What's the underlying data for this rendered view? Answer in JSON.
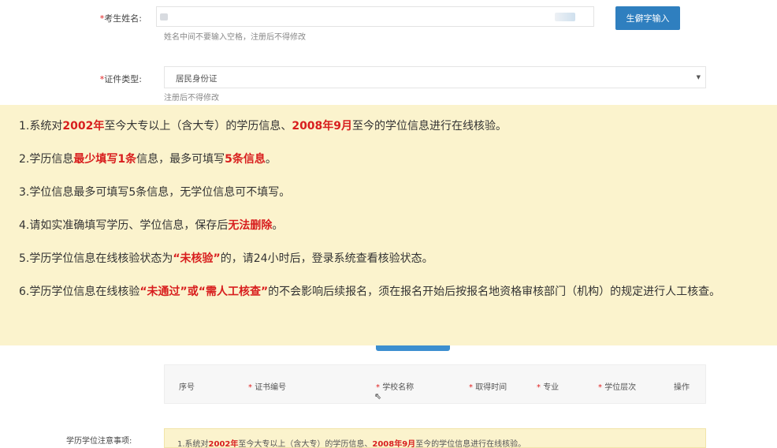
{
  "form": {
    "name_label": "考生姓名:",
    "name_required": "*",
    "name_hint": "姓名中间不要输入空格，注册后不得修改",
    "pinyin_button": "生僻字输入",
    "id_type_label": "证件类型:",
    "id_type_required": "*",
    "id_type_value": "居民身份证",
    "id_type_arrow": "▼",
    "id_type_hint": "注册后不得修改"
  },
  "notice": {
    "line1": {
      "p1": "1.系统对",
      "h1": "2002年",
      "p2": "至今大专以上（含大专）的学历信息、",
      "h2": "2008年9月",
      "p3": "至今的学位信息进行在线核验。"
    },
    "line2": {
      "p1": "2.学历信息",
      "h1": "最少填写1条",
      "p2": "信息，最多可填写",
      "h2": "5条信息",
      "p3": "。"
    },
    "line3": "3.学位信息最多可填写5条信息，无学位信息可不填写。",
    "line4": {
      "p1": "4.请如实准确填写学历、学位信息，保存后",
      "h1": "无法删除",
      "p2": "。"
    },
    "line5": {
      "p1": "5.学历学位信息在线核验状态为",
      "h1": "“未核验”",
      "p2": "的，请24小时后，登录系统查看核验状态。"
    },
    "line6": {
      "p1": "6.学历学位信息在线核验",
      "h1": "“未通过”或“需人工核查”",
      "p2": "的不会影响后续报名，须在报名开始后按报名地资格审核部门（机构）的规定进行人工核查。"
    }
  },
  "table": {
    "columns": [
      {
        "label": "序号",
        "required": ""
      },
      {
        "label": "证书编号",
        "required": "*"
      },
      {
        "label": "学校名称",
        "required": "*"
      },
      {
        "label": "取得时间",
        "required": "*"
      },
      {
        "label": "专业",
        "required": "*"
      },
      {
        "label": "学位层次",
        "required": "*"
      },
      {
        "label": "操作",
        "required": ""
      }
    ]
  },
  "bottom": {
    "label": "学历学位注意事项:",
    "notice_p1": "1.系统对",
    "notice_h1": "2002年",
    "notice_p2": "至今大专以上（含大专）的学历信息、",
    "notice_h2": "2008年9月",
    "notice_p3": "至今的学位信息进行在线核验。"
  }
}
